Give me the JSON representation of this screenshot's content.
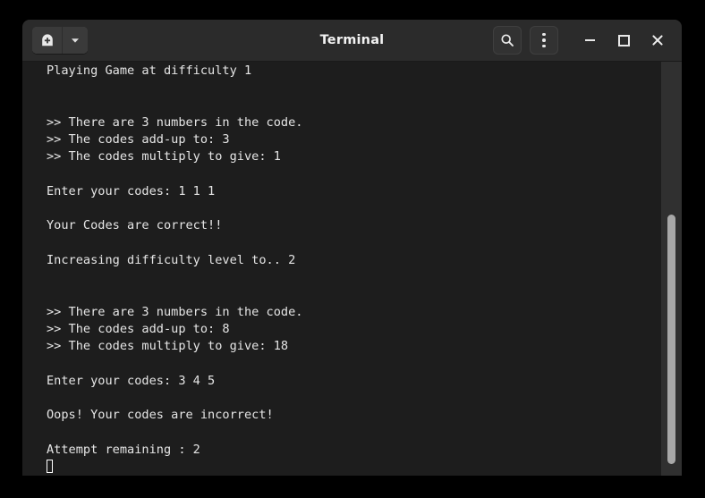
{
  "window": {
    "title": "Terminal"
  },
  "titlebar": {
    "new_tab_button": {
      "label": "",
      "icon": "new-tab-icon",
      "tooltip": "New Tab"
    },
    "new_tab_dropdown": {
      "label": "",
      "icon": "chevron-down-icon"
    },
    "search_button": {
      "label": "",
      "icon": "search-icon"
    },
    "menu_button": {
      "label": "",
      "icon": "kebab-menu-icon"
    },
    "minimize_button": {
      "label": "",
      "icon": "minimize-icon"
    },
    "maximize_button": {
      "label": "",
      "icon": "maximize-icon"
    },
    "close_button": {
      "label": "✕",
      "icon": "close-icon"
    }
  },
  "terminal": {
    "lines": [
      "Playing Game at difficulty 1",
      "",
      "",
      ">> There are 3 numbers in the code.",
      ">> The codes add-up to: 3",
      ">> The codes multiply to give: 1",
      "",
      "Enter your codes: 1 1 1",
      "",
      "Your Codes are correct!!",
      "",
      "Increasing difficulty level to.. 2",
      "",
      "",
      ">> There are 3 numbers in the code.",
      ">> The codes add-up to: 8",
      ">> The codes multiply to give: 18",
      "",
      "Enter your codes: 3 4 5",
      "",
      "Oops! Your codes are incorrect!",
      "",
      "Attempt remaining : 2"
    ],
    "cursor": {
      "shape": "hollow-block",
      "row": 23,
      "column": 1
    },
    "colors": {
      "background": "#1d1d1d",
      "foreground": "#e6e6e6",
      "titlebar": "#2b2b2b",
      "scrollbar_track": "#303030",
      "scrollbar_thumb": "#a8a8a8"
    }
  },
  "scrollbar": {
    "position_label": ""
  }
}
